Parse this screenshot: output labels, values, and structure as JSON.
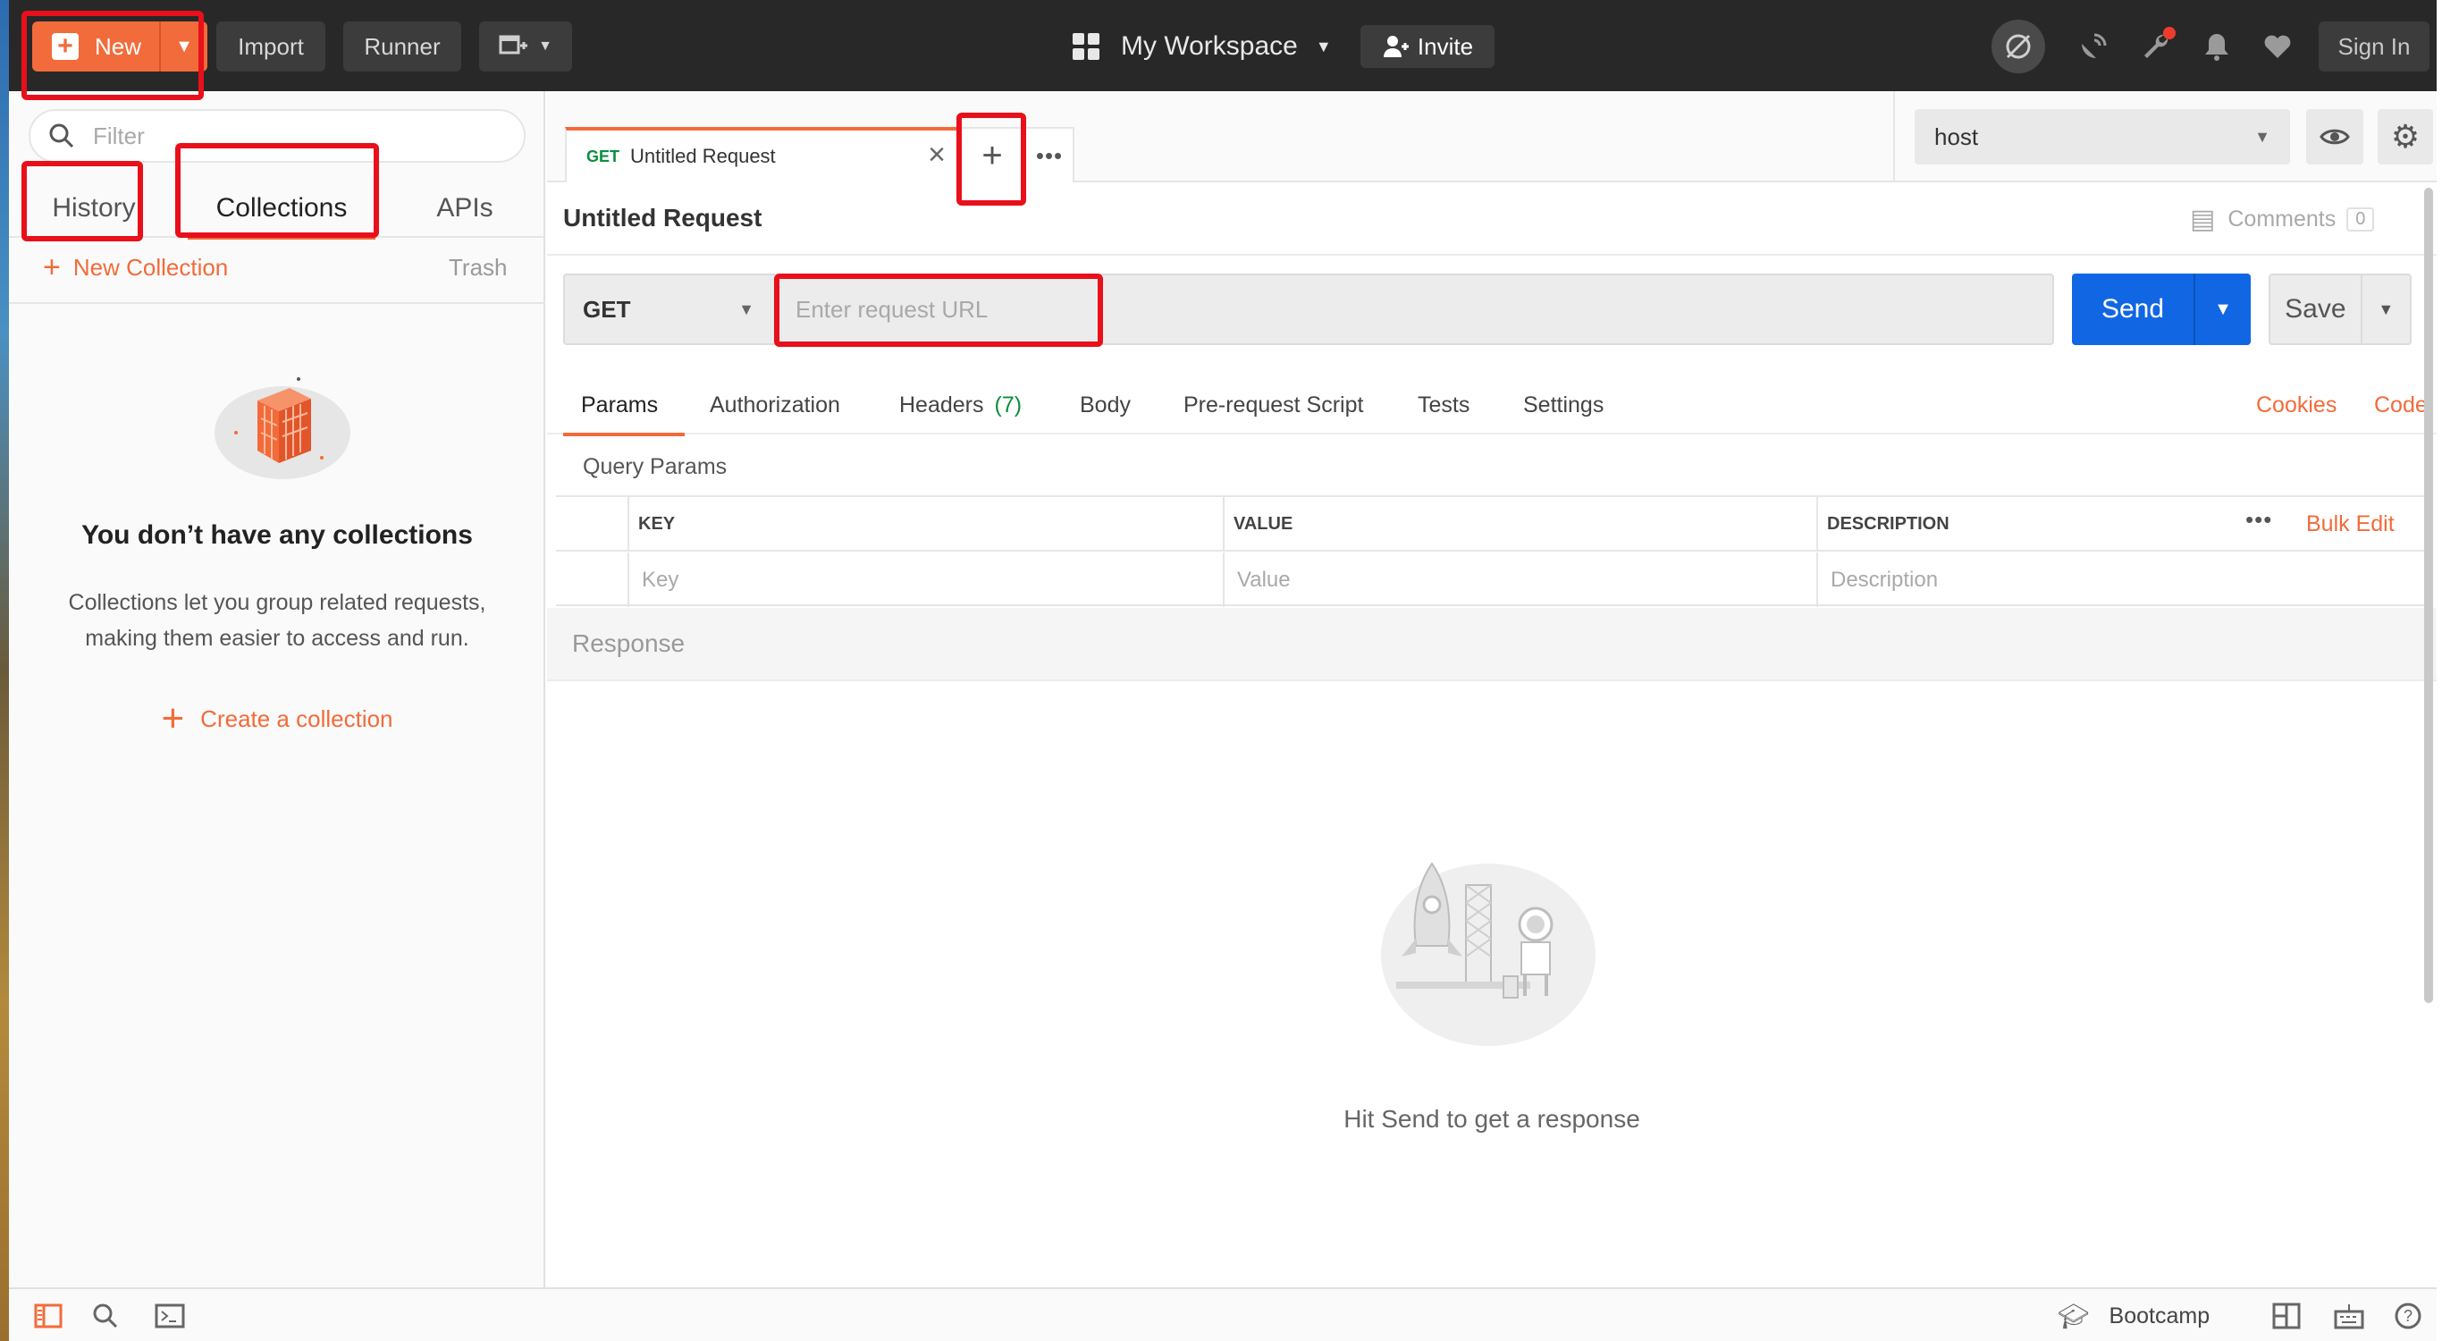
{
  "topbar": {
    "new_label": "New",
    "import_label": "Import",
    "runner_label": "Runner",
    "workspace_label": "My Workspace",
    "invite_label": "Invite",
    "signin_label": "Sign In"
  },
  "sidebar": {
    "filter_placeholder": "Filter",
    "tabs": [
      "History",
      "Collections",
      "APIs"
    ],
    "active_tab": "Collections",
    "new_collection_label": "New Collection",
    "trash_label": "Trash",
    "empty_title": "You don’t have any collections",
    "empty_desc": "Collections let you group related requests, making them easier to access and run.",
    "create_label": "Create a collection"
  },
  "request_tab": {
    "method": "GET",
    "name": "Untitled Request"
  },
  "environment": {
    "selected": "host"
  },
  "request": {
    "title": "Untitled Request",
    "comments_label": "Comments",
    "comments_count": "0",
    "method": "GET",
    "url_placeholder": "Enter request URL",
    "send_label": "Send",
    "save_label": "Save"
  },
  "request_tabs": {
    "params": "Params",
    "authorization": "Authorization",
    "headers": "Headers",
    "headers_count": "(7)",
    "body": "Body",
    "prerequest": "Pre-request Script",
    "tests": "Tests",
    "settings": "Settings",
    "cookies": "Cookies",
    "code": "Code"
  },
  "params_table": {
    "title": "Query Params",
    "headers": [
      "KEY",
      "VALUE",
      "DESCRIPTION"
    ],
    "placeholders": [
      "Key",
      "Value",
      "Description"
    ],
    "bulk_edit": "Bulk Edit"
  },
  "response": {
    "label": "Response",
    "empty_text": "Hit Send to get a response"
  },
  "statusbar": {
    "bootcamp_label": "Bootcamp"
  },
  "colors": {
    "accent": "#f26b3a",
    "send_blue": "#1166e3",
    "highlight_red": "#e8101a"
  }
}
